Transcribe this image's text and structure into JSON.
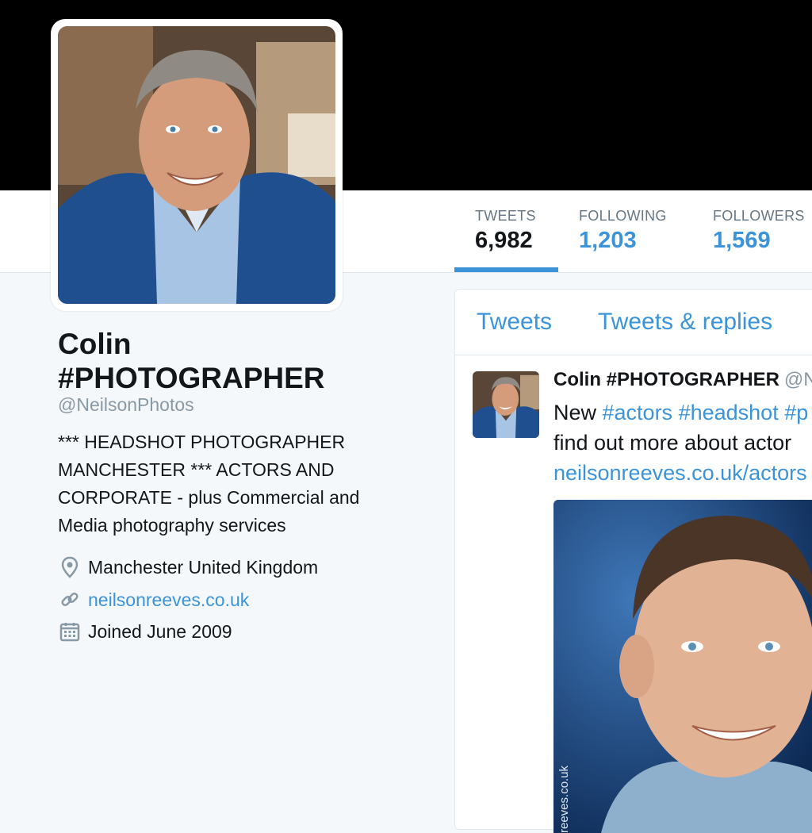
{
  "profile": {
    "name": "Colin #PHOTOGRAPHER",
    "handle": "@NeilsonPhotos",
    "bio": "*** HEADSHOT PHOTOGRAPHER MANCHESTER *** ACTORS AND CORPORATE - plus Commercial and Media photography services",
    "location": "Manchester United Kingdom",
    "website": "neilsonreeves.co.uk",
    "joined": "Joined June 2009"
  },
  "stats": {
    "tweets": {
      "label": "TWEETS",
      "value": "6,982"
    },
    "following": {
      "label": "FOLLOWING",
      "value": "1,203"
    },
    "followers": {
      "label": "FOLLOWERS",
      "value": "1,569"
    }
  },
  "timeline": {
    "tabs": [
      "Tweets",
      "Tweets & replies"
    ],
    "tweet": {
      "author": "Colin #PHOTOGRAPHER",
      "handle": "@N",
      "line1_prefix": "New ",
      "hashtags": [
        "#actors",
        "#headshot",
        "#p"
      ],
      "line2": "find out more about actor",
      "link": "neilsonreeves.co.uk/actors",
      "media_watermark": "reeves.co.uk"
    }
  },
  "colors": {
    "accent": "#3b94d9",
    "banner": "#000000",
    "background": "#f5f8fa"
  },
  "icons": {
    "location": "map-pin-icon",
    "website": "link-icon",
    "joined": "calendar-icon"
  }
}
